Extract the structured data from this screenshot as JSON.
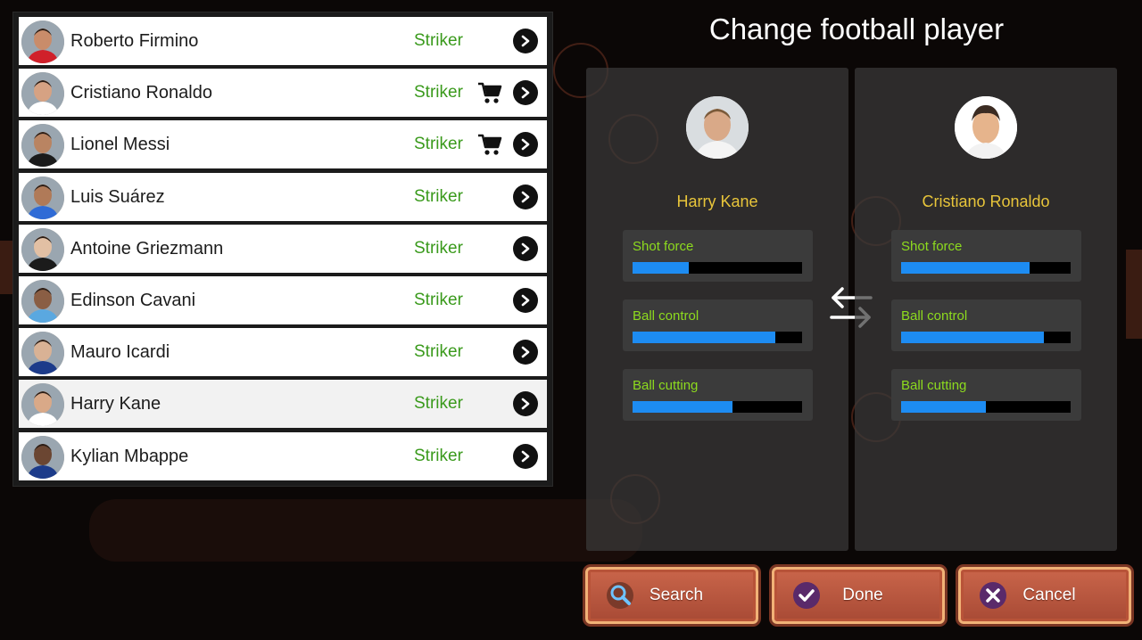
{
  "title": "Change football player",
  "players": [
    {
      "name": "Roberto Firmino",
      "position": "Striker",
      "cart": false
    },
    {
      "name": "Cristiano Ronaldo",
      "position": "Striker",
      "cart": true
    },
    {
      "name": "Lionel Messi",
      "position": "Striker",
      "cart": true
    },
    {
      "name": "Luis Suárez",
      "position": "Striker",
      "cart": false
    },
    {
      "name": "Antoine Griezmann",
      "position": "Striker",
      "cart": false
    },
    {
      "name": "Edinson Cavani",
      "position": "Striker",
      "cart": false
    },
    {
      "name": "Mauro Icardi",
      "position": "Striker",
      "cart": false
    },
    {
      "name": "Harry Kane",
      "position": "Striker",
      "cart": false,
      "selected": true
    },
    {
      "name": "Kylian Mbappe",
      "position": "Striker",
      "cart": false
    }
  ],
  "current": {
    "name": "Harry Kane",
    "stats": [
      {
        "label": "Shot force",
        "value": 0.33
      },
      {
        "label": "Ball control",
        "value": 0.84
      },
      {
        "label": "Ball cutting",
        "value": 0.59
      }
    ]
  },
  "candidate": {
    "name": "Cristiano Ronaldo",
    "stats": [
      {
        "label": "Shot force",
        "value": 0.76
      },
      {
        "label": "Ball control",
        "value": 0.84
      },
      {
        "label": "Ball cutting",
        "value": 0.5
      }
    ]
  },
  "buttons": {
    "search": "Search",
    "done": "Done",
    "cancel": "Cancel"
  },
  "colors": {
    "position_text": "#3a9a1c",
    "name_highlight": "#e8c53a",
    "stat_label": "#8ddb1e",
    "stat_bar": "#1d8cf2"
  }
}
